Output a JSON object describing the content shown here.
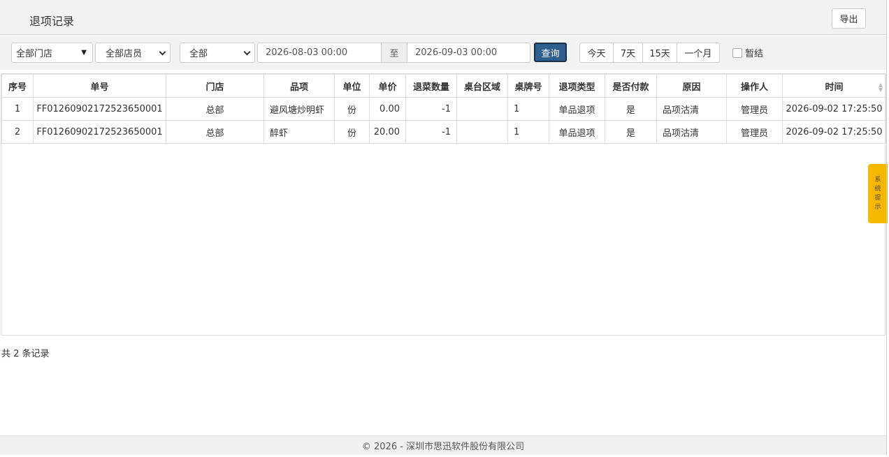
{
  "header": {
    "title": "退项记录",
    "export_label": "导出"
  },
  "filters": {
    "store": "全部门店",
    "staff": "全部店员",
    "type": "全部",
    "date_from": "2026-08-03 00:00",
    "date_sep": "至",
    "date_to": "2026-09-03 00:00",
    "query_label": "查询",
    "quick": [
      "今天",
      "7天",
      "15天",
      "一个月"
    ],
    "pending_label": "暂结"
  },
  "table": {
    "columns": [
      "序号",
      "单号",
      "门店",
      "品项",
      "单位",
      "单价",
      "退菜数量",
      "桌台区域",
      "桌牌号",
      "退项类型",
      "是否付款",
      "原因",
      "操作人",
      "时间"
    ],
    "rows": [
      [
        "1",
        "FF01260902172523650001",
        "总部",
        "避风塘炒明虾",
        "份",
        "0.00",
        "-1",
        "",
        "1",
        "单品退项",
        "是",
        "品项沽清",
        "管理员",
        "2026-09-02 17:25:50"
      ],
      [
        "2",
        "FF01260902172523650001",
        "总部",
        "醉虾",
        "份",
        "20.00",
        "-1",
        "",
        "1",
        "单品退项",
        "是",
        "品项沽清",
        "管理员",
        "2026-09-02 17:25:50"
      ]
    ]
  },
  "side_tab": [
    "系",
    "统",
    "提",
    "示"
  ],
  "total_text": "共 2 条记录",
  "footer": "© 2026 - 深圳市思迅软件股份有限公司",
  "colors": {
    "query_button": "#2f5f8f",
    "side_tab": "#f5b800"
  },
  "icons": {
    "sort": "sort-icon",
    "dropdown": "chevron-down-icon"
  }
}
